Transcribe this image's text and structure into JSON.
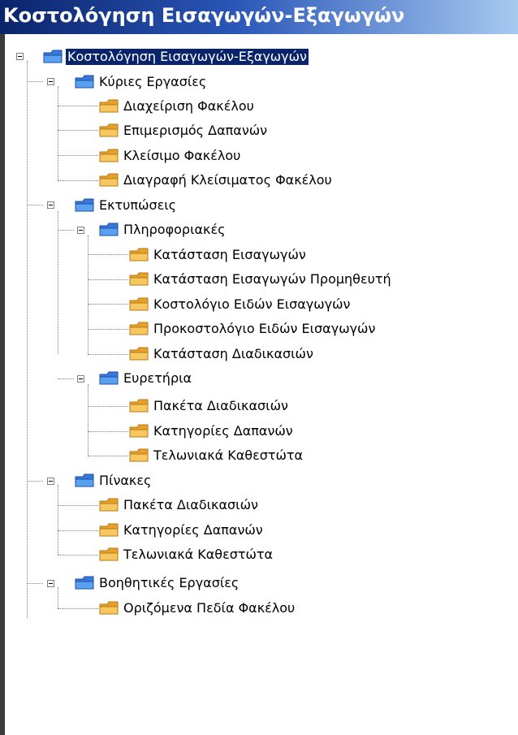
{
  "window": {
    "title": "Κοστολόγηση Εισαγωγών-Εξαγωγών"
  },
  "tree": {
    "root": {
      "label": "Κοστολόγηση Εισαγωγών-Εξαγωγών",
      "icon": "blue-folder-icon",
      "selected": true
    },
    "main_tasks": {
      "label": "Κύριες Εργασίες",
      "items": [
        "Διαχείριση Φακέλου",
        "Επιμερισμός Δαπανών",
        "Κλείσιμο Φακέλου",
        "Διαγραφή Κλείσιματος Φακέλου"
      ]
    },
    "printouts": {
      "label": "Εκτυπώσεις",
      "informational": {
        "label": "Πληροφοριακές",
        "items": [
          "Κατάσταση Εισαγωγών",
          "Κατάσταση Εισαγωγών Προμηθευτή",
          "Κοστολόγιο Ειδών Εισαγωγών",
          "Προκοστολόγιο Ειδών Εισαγωγών",
          "Κατάσταση Διαδικασιών"
        ]
      },
      "indexes": {
        "label": "Ευρετήρια",
        "items": [
          "Πακέτα Διαδικασιών",
          "Κατηγορίες Δαπανών",
          "Τελωνιακά Καθεστώτα"
        ]
      }
    },
    "tables": {
      "label": "Πίνακες",
      "items": [
        "Πακέτα Διαδικασιών",
        "Κατηγορίες Δαπανών",
        "Τελωνιακά Καθεστώτα"
      ]
    },
    "auxiliary": {
      "label": "Βοηθητικές Εργασίες",
      "items": [
        "Οριζόμενα Πεδία Φακέλου"
      ]
    }
  },
  "colors": {
    "titlebar_start": "#0a246a",
    "titlebar_end": "#a6caf0",
    "selection": "#0a246a",
    "blue_folder": "#3a78d8",
    "yellow_folder": "#f4b43c"
  }
}
